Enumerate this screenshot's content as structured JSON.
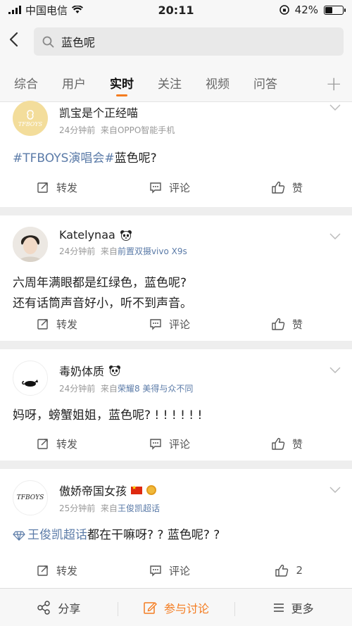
{
  "status_bar": {
    "carrier": "中国电信",
    "time": "20:11",
    "battery": "42%",
    "battery_level": 0.42
  },
  "search": {
    "query": "蓝色呢"
  },
  "tabs": [
    {
      "label": "综合"
    },
    {
      "label": "用户"
    },
    {
      "label": "实时"
    },
    {
      "label": "关注"
    },
    {
      "label": "视频"
    },
    {
      "label": "问答"
    }
  ],
  "tab_add": "+",
  "posts": [
    {
      "user": "凯宝是个正经喵",
      "avatar_text": "TFBOYS",
      "time": "24分钟前",
      "source_prefix": "来自",
      "source": "OPPO智能手机",
      "topic": "#TFBOYS演唱会#",
      "text": "蓝色呢?",
      "repost": "转发",
      "comment": "评论",
      "like": "赞"
    },
    {
      "user": "Katelynaa",
      "time": "24分钟前",
      "source_prefix": "来自",
      "source": "前置双摄vivo X9s",
      "line1": "六周年满眼都是红绿色，蓝色呢?",
      "line2": "还有话筒声音好小，听不到声音。",
      "repost": "转发",
      "comment": "评论",
      "like": "赞"
    },
    {
      "user": "毒奶体质",
      "time": "24分钟前",
      "source_prefix": "来自",
      "source": "荣耀8 美得与众不同",
      "text": "妈呀，螃蟹姐姐，蓝色呢? ! ! ! ! ! !",
      "repost": "转发",
      "comment": "评论",
      "like": "赞"
    },
    {
      "user": "傲娇帝国女孩",
      "avatar_text": "TFBOYS",
      "time": "25分钟前",
      "source_prefix": "来自",
      "source": "王俊凯超话",
      "topic": "王俊凯超话",
      "text": "都在干嘛呀? ? 蓝色呢? ?",
      "repost": "转发",
      "comment": "评论",
      "like": "2"
    }
  ],
  "bottom_bar": {
    "share": "分享",
    "discuss": "参与讨论",
    "more": "更多"
  },
  "colors": {
    "accent": "#f47c20",
    "link": "#5b7ba8"
  }
}
